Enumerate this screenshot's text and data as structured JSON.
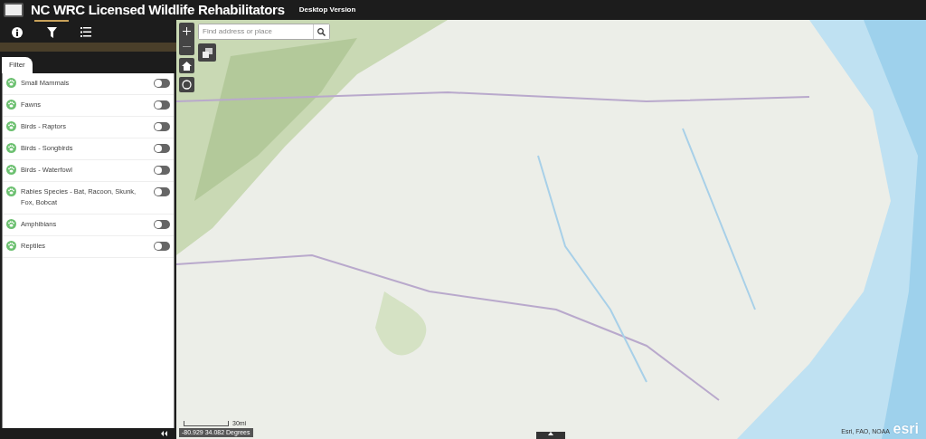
{
  "header": {
    "title": "NC WRC Licensed Wildlife Rehabilitators",
    "subtitle": "Desktop Version"
  },
  "panel_tabs": [
    {
      "kind": "info",
      "selected": false
    },
    {
      "kind": "filter",
      "selected": true
    },
    {
      "kind": "list",
      "selected": false
    }
  ],
  "filter": {
    "tab_label": "Filter",
    "items": [
      {
        "label": "Small Mammals",
        "on": false
      },
      {
        "label": "Fawns",
        "on": false
      },
      {
        "label": "Birds - Raptors",
        "on": false
      },
      {
        "label": "Birds - Songbirds",
        "on": false
      },
      {
        "label": "Birds - Waterfowl",
        "on": false
      },
      {
        "label": "Rabies Species - Bat, Racoon, Skunk, Fox, Bobcat",
        "on": false
      },
      {
        "label": "Amphibians",
        "on": false
      },
      {
        "label": "Reptiles",
        "on": false
      }
    ]
  },
  "map": {
    "search": {
      "placeholder": "Find address or place"
    },
    "scale_label": "30mi",
    "coordinates": "-80.929 34.082 Degrees",
    "attribution": "Esri, FAO, NOAA",
    "logo_text": "esri"
  }
}
